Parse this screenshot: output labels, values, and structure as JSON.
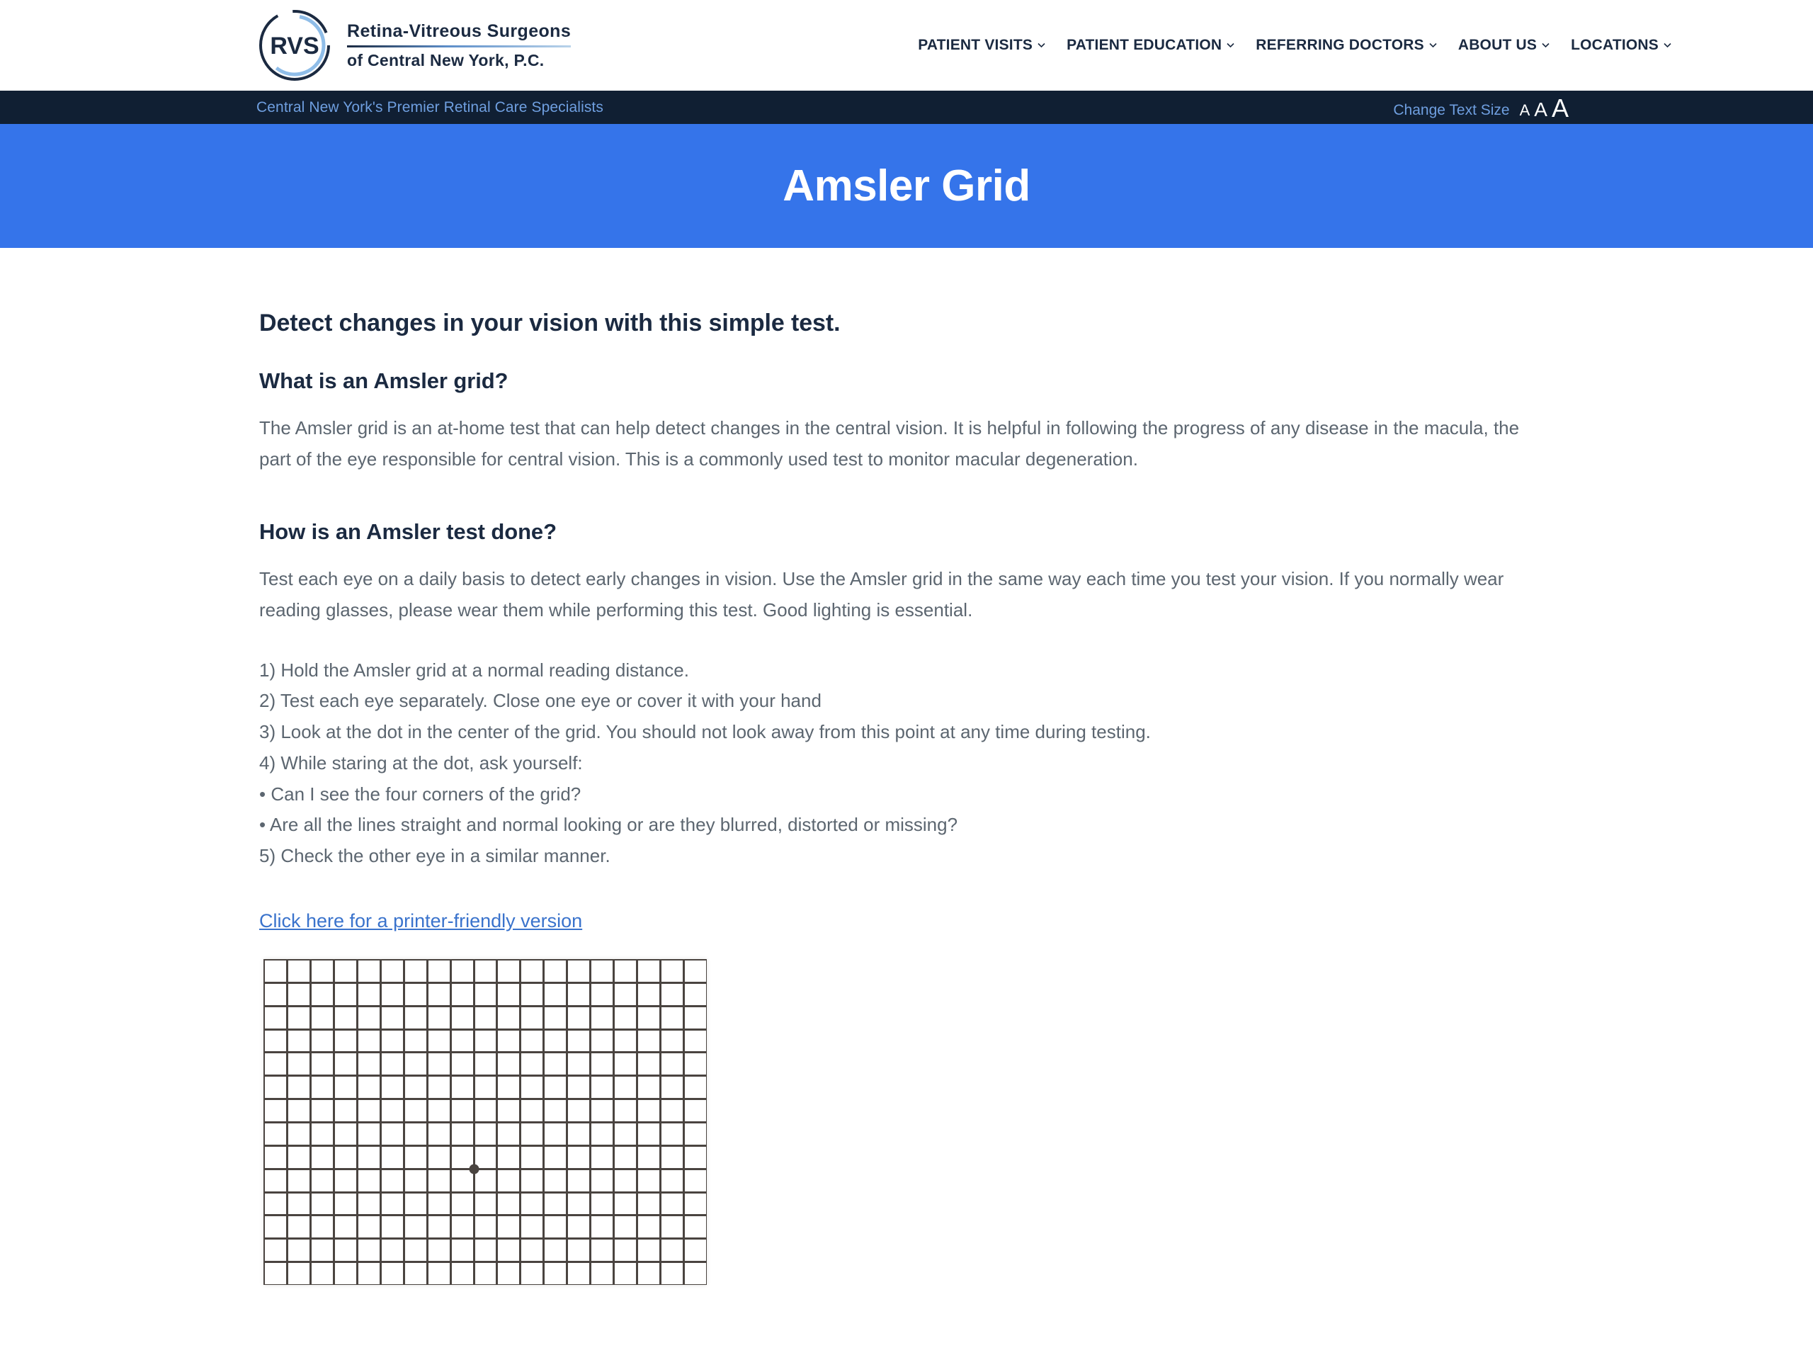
{
  "header": {
    "logo": {
      "monogram": "RVS",
      "line1": "Retina-Vitreous Surgeons",
      "line2": "of Central New York, P.C."
    },
    "nav_items": [
      {
        "label": "PATIENT VISITS",
        "icon": "chevron-down-icon"
      },
      {
        "label": "PATIENT EDUCATION",
        "icon": "chevron-down-icon"
      },
      {
        "label": "REFERRING DOCTORS",
        "icon": "chevron-down-icon"
      },
      {
        "label": "ABOUT US",
        "icon": "chevron-down-icon"
      },
      {
        "label": "LOCATIONS",
        "icon": "chevron-down-icon"
      }
    ]
  },
  "tagline_bar": {
    "tagline": "Central New York's Premier Retinal Care Specialists",
    "text_size_label": "Change Text Size",
    "text_size_options": [
      "A",
      "A",
      "A"
    ],
    "background_color": "#101f33",
    "tagline_color": "#6f9fe0"
  },
  "banner": {
    "title": "Amsler Grid",
    "background_color": "#3574ea",
    "text_color": "#ffffff"
  },
  "main": {
    "lead_heading": "Detect changes in your vision with this simple test.",
    "section_1": {
      "heading": "What is an Amsler grid?",
      "paragraph": "The Amsler grid is an at-home test that can help detect changes in the central vision. It is helpful in following the progress of any disease in the macula, the part of the eye responsible for central vision. This is a commonly used test to monitor macular degeneration."
    },
    "section_2": {
      "heading": "How is an Amsler test done?",
      "paragraph": "Test each eye on a daily basis to detect early changes in vision. Use the Amsler grid in the same way each time you test your vision. If you normally wear reading glasses, please wear them while performing this test. Good lighting is essential.",
      "steps": [
        "1) Hold the Amsler grid at a normal reading distance.",
        "2) Test each eye separately. Close one eye or cover it with your hand",
        "3) Look at the dot in the center of the grid. You should not look away from this point at any time during testing.",
        "4) While staring at the dot, ask yourself:",
        "• Can I see the four corners of the grid?",
        "• Are all the lines straight and normal looking or are they blurred, distorted or missing?",
        "5) Check the other eye in a similar manner."
      ]
    },
    "printer_link": "Click here for a printer-friendly version",
    "amsler_image": {
      "name": "amsler-grid-image",
      "columns": 19,
      "rows": 14,
      "line_color": "#4a4440",
      "background_color": "#ffffff",
      "center_dot": true
    }
  },
  "colors": {
    "accent_blue": "#3574ea",
    "dark_navy": "#101f33",
    "heading_navy": "#1b2a41",
    "body_gray": "#5c6670",
    "link_blue": "#3a73cc"
  }
}
